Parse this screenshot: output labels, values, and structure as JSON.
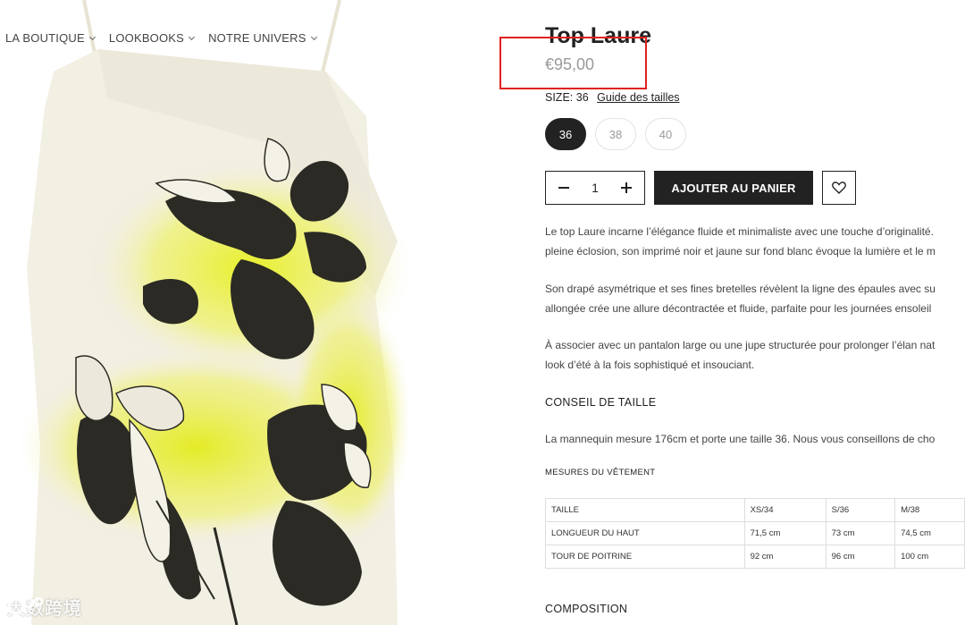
{
  "nav": {
    "items": [
      {
        "label": "LA BOUTIQUE"
      },
      {
        "label": "LOOKBOOKS"
      },
      {
        "label": "NOTRE UNIVERS"
      }
    ]
  },
  "watermark": {
    "text": "大数跨境"
  },
  "product": {
    "title": "Top Laure",
    "price": "€95,00",
    "size_label": "SIZE:",
    "size_value": "36",
    "size_guide": "Guide des tailles",
    "sizes": [
      "36",
      "38",
      "40"
    ],
    "selected_size": "36",
    "quantity": "1",
    "add_to_cart": "AJOUTER AU PANIER",
    "description": [
      "Le top Laure incarne l’élégance fluide et minimaliste avec une touche d’originalité.",
      "pleine éclosion, son imprimé noir et jaune sur fond blanc évoque la lumière et le m",
      "Son drapé asymétrique et ses fines bretelles révèlent la ligne des épaules avec su",
      "allongée crée une allure décontractée et fluide, parfaite pour les journées ensoleil",
      "À associer avec un pantalon large ou une jupe structurée pour prolonger l’élan nat",
      "look d’été à la fois sophistiqué et insouciant."
    ],
    "size_advice_title": "CONSEIL DE TAILLE",
    "size_advice_text": "La mannequin mesure 176cm et porte une taille 36. Nous vous conseillons de cho",
    "measures_title": "MESURES DU VÊTEMENT",
    "measures_table": {
      "headers": [
        "TAILLE",
        "XS/34",
        "S/36",
        "M/38"
      ],
      "rows": [
        [
          "LONGUEUR DU HAUT",
          "71,5 cm",
          "73 cm",
          "74,5 cm"
        ],
        [
          "TOUR DE POITRINE",
          "92 cm",
          "96 cm",
          "100 cm"
        ]
      ]
    },
    "composition_title": "COMPOSITION"
  },
  "colors": {
    "accent": "#222222",
    "highlight": "#e02020",
    "price": "#999999",
    "print_yellow": "#e6ee3a"
  }
}
